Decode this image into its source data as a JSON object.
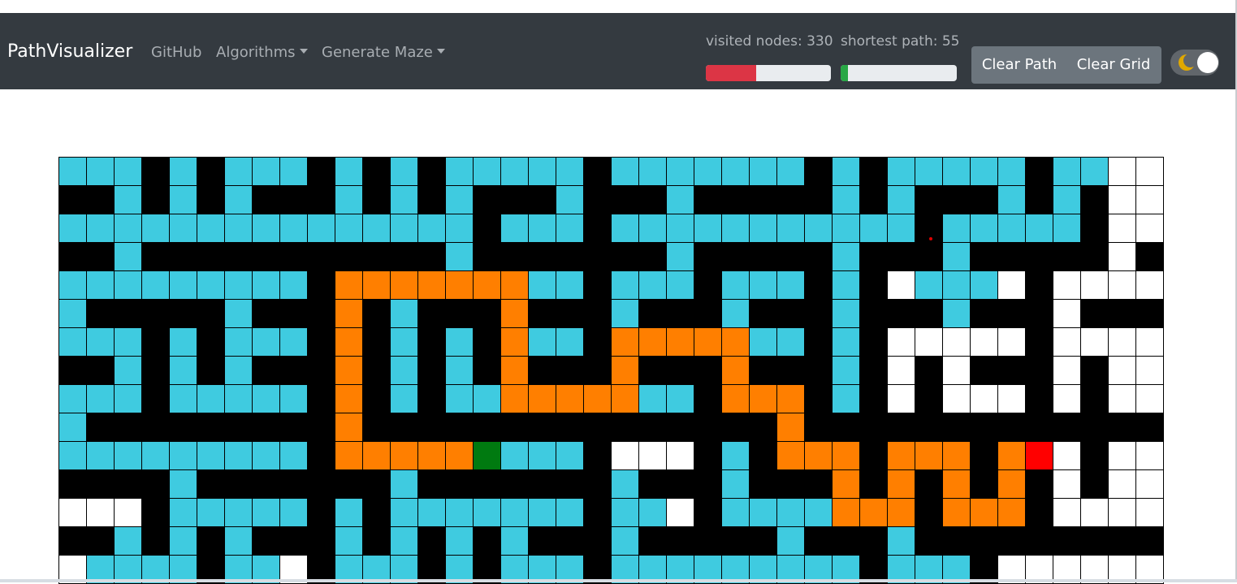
{
  "navbar": {
    "brand": "PathVisualizer",
    "links": [
      {
        "label": "GitHub",
        "dropdown": false
      },
      {
        "label": "Algorithms",
        "dropdown": true
      },
      {
        "label": "Generate Maze",
        "dropdown": true
      }
    ],
    "visited_label": "visited nodes: 330",
    "visited_fraction": 0.4,
    "shortest_label": "shortest path: 55",
    "shortest_fraction": 0.06,
    "clear_path": "Clear Path",
    "clear_grid": "Clear Grid",
    "theme_toggle_on": true
  },
  "colors": {
    "navbar_bg": "#343a40",
    "visited": "#3fcbe0",
    "wall": "#000000",
    "empty": "#ffffff",
    "path": "#ff7f00",
    "start": "#007a10",
    "target": "#ff0000",
    "visited_bar": "#dc3545",
    "shortest_bar": "#28a745"
  },
  "grid": {
    "columns": 40,
    "legend": {
      "V": "visited-node",
      "W": "wall",
      "E": "empty-node",
      "P": "path-node",
      "S": "start-node",
      "T": "target-node"
    },
    "rows": [
      "VVVWVWVVVWVWVWVVVVVWVVVVVVVWVWVVVVVWVVEE",
      "WWVWVWVWWWVWVWVWWWVWWWVWWWWWVWVWWWVWVWEE",
      "VVVVVVVVVVVVVVVWVVVWVVVVVVVVVVVWVVVVVWEE",
      "WWVWWWWWWWWWWWVWWWWWWWVWWWWWVWWWVWWWWWEW",
      "VVVVVVVVVWPPPPPPPVVWVVVWVVVWVWEVVVEWEEEE",
      "VWWWWWVWWWPWVWWWPWWWVWWWVWWWVWWWVWWWEWWW",
      "VVVWVWVVVWPWVWVWPVVWPPPPPVVWVWEEEEEWEEEE",
      "WWVWVWVWWWPWVWVWPWWWPWWWPWWWVWEWEWWWEWEE",
      "VVVWVVVVVWPWVWVVPPPPPVVWPPPWVWEWEEEWEWEE",
      "VWWWWWWWWWPWWWWWWWWWWWWWWWPWWWWWWWWWWWWW",
      "VVVVVVVVVWPPPPPSVVVWEEEWVWPPPWPPPWPTEWEE",
      "WWWWVWWWWWWWVWWWWWWWVWWWVWWWPWPWPWPWEWEE",
      "EEEWVVVVVWVWVVVVVVVWVVEWVVVVPPPWPPPWEEEE",
      "WWVWVWVWWWVWVWVWVWWWVWWWWWVWWWVWWWWWWWWW",
      "EVVVVWVVEWVVVWVWVVVWVVVVVVVVVWVVVWEEEEEE"
    ]
  }
}
